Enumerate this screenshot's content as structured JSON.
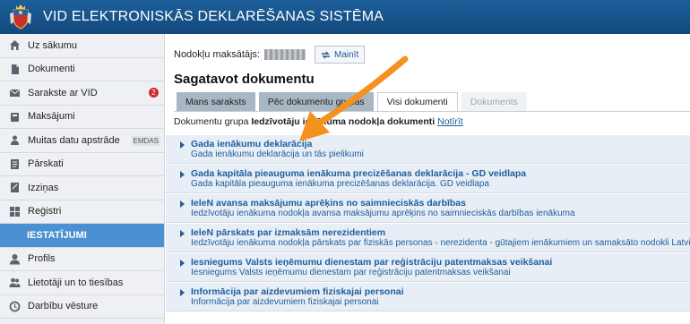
{
  "header": {
    "title": "VID ELEKTRONISKĀS DEKLARĒŠANAS SISTĒMA",
    "logo_icon": "latvia-coat-of-arms-icon"
  },
  "sidebar": {
    "items": [
      {
        "label": "Uz sākumu",
        "icon": "home-icon"
      },
      {
        "label": "Dokumenti",
        "icon": "document-icon"
      },
      {
        "label": "Sarakste ar VID",
        "icon": "envelope-icon",
        "badge": "2"
      },
      {
        "label": "Maksājumi",
        "icon": "money-icon"
      },
      {
        "label": "Muitas datu apstrāde",
        "icon": "customs-icon",
        "tag": "EMDAS"
      },
      {
        "label": "Pārskati",
        "icon": "report-icon"
      },
      {
        "label": "Izziņas",
        "icon": "certificate-icon"
      },
      {
        "label": "Reģistri",
        "icon": "grid-icon"
      },
      {
        "label": "IESTATĪJUMI",
        "icon": ""
      },
      {
        "label": "Profils",
        "icon": "user-icon"
      },
      {
        "label": "Lietotāji un to tiesības",
        "icon": "users-icon"
      },
      {
        "label": "Darbību vēsture",
        "icon": "history-icon"
      }
    ]
  },
  "main": {
    "payer_label": "Nodokļu maksātājs:",
    "change_label": "Mainīt",
    "page_title": "Sagatavot dokumentu",
    "tabs": [
      {
        "label": "Mans saraksts",
        "state": "normal"
      },
      {
        "label": "Pēc dokumentu grupas",
        "state": "normal"
      },
      {
        "label": "Visi dokumenti",
        "state": "active"
      },
      {
        "label": "Dokuments",
        "state": "disabled"
      }
    ],
    "group": {
      "prefix": "Dokumentu grupa ",
      "name": "Iedzīvotāju ienākuma nodokļa dokumenti",
      "clear_label": "Notīrīt"
    },
    "documents": [
      {
        "title": "Gada ienākumu deklarācija",
        "subtitle": "Gada ienākumu deklarācija un tās pielikumi"
      },
      {
        "title": "Gada kapitāla pieauguma ienākuma precizēšanas deklarācija - GD veidlapa",
        "subtitle": "Gada kapitāla pieauguma ienākuma precizēšanas deklarācija. GD veidlapa"
      },
      {
        "title": "IeleN avansa maksājumu aprēķins no saimnieciskās darbības",
        "subtitle": "Iedzīvotāju ienākuma nodokļa avansa maksājumu aprēķins no saimnieciskās darbības ienākuma"
      },
      {
        "title": "IeleN pārskats par izmaksām nerezidentiem",
        "subtitle": "Iedzīvotāju ienākuma nodokļa pārskats par fiziskās personas - nerezidenta - gūtajiem ienākumiem un samaksāto nodokli Latvijas Rep"
      },
      {
        "title": "Iesniegums Valsts ieņēmumu dienestam par reģistrāciju patentmaksas veikšanai",
        "subtitle": "Iesniegums Valsts ieņēmumu dienestam par reģistrāciju patentmaksas veikšanai"
      },
      {
        "title": "Informācija par aizdevumiem fiziskajai personai",
        "subtitle": "Informācija par aizdevumiem fiziskajai personai"
      }
    ]
  },
  "colors": {
    "brand": "#12497c",
    "accent": "#4a90d2",
    "link": "#1f5d9b",
    "arrow": "#f5911e"
  }
}
